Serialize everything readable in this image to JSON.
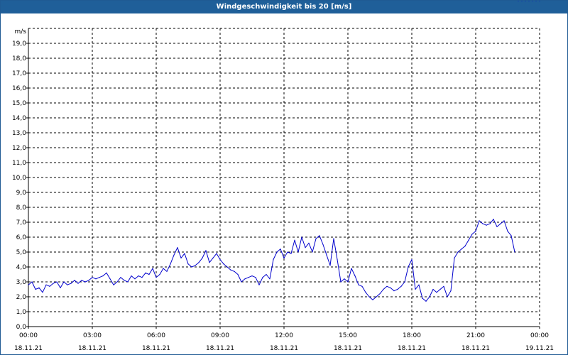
{
  "window": {
    "title": "Windgeschwindigkeit bis 20 [m/s]"
  },
  "chart_data": {
    "type": "line",
    "title": "Windgeschwindigkeit bis 20 [m/s]",
    "ylabel": "m/s",
    "ylim": [
      0,
      20
    ],
    "grid": true,
    "y_tick_labels": [
      "0,0",
      "1,0",
      "2,0",
      "3,0",
      "4,0",
      "5,0",
      "6,0",
      "7,0",
      "8,0",
      "9,0",
      "10,0",
      "11,0",
      "12,0",
      "13,0",
      "14,0",
      "15,0",
      "16,0",
      "17,0",
      "18,0",
      "19,0"
    ],
    "x_ticks": [
      {
        "time": "00:00",
        "date": "18.11.21"
      },
      {
        "time": "03:00",
        "date": "18.11.21"
      },
      {
        "time": "06:00",
        "date": "18.11.21"
      },
      {
        "time": "09:00",
        "date": "18.11.21"
      },
      {
        "time": "12:00",
        "date": "18.11.21"
      },
      {
        "time": "15:00",
        "date": "18.11.21"
      },
      {
        "time": "18:00",
        "date": "18.11.21"
      },
      {
        "time": "21:00",
        "date": "18.11.21"
      },
      {
        "time": "00:00",
        "date": "19.11.21"
      }
    ],
    "series": [
      {
        "color": "#0000cc",
        "x_hours": [
          0,
          0.1667,
          0.3333,
          0.5,
          0.6667,
          0.8333,
          1,
          1.1667,
          1.3333,
          1.5,
          1.6667,
          1.8333,
          2,
          2.1667,
          2.3333,
          2.5,
          2.6667,
          2.8333,
          3,
          3.1667,
          3.3333,
          3.5,
          3.6667,
          3.8333,
          4,
          4.1667,
          4.3333,
          4.5,
          4.6667,
          4.8333,
          5,
          5.1667,
          5.3333,
          5.5,
          5.6667,
          5.8333,
          6,
          6.1667,
          6.3333,
          6.5,
          6.6667,
          6.8333,
          7,
          7.1667,
          7.3333,
          7.5,
          7.6667,
          7.8333,
          8,
          8.1667,
          8.3333,
          8.5,
          8.6667,
          8.8333,
          9,
          9.1667,
          9.3333,
          9.5,
          9.6667,
          9.8333,
          10,
          10.1667,
          10.3333,
          10.5,
          10.6667,
          10.8333,
          11,
          11.1667,
          11.3333,
          11.5,
          11.6667,
          11.8333,
          12,
          12.1667,
          12.3333,
          12.5,
          12.6667,
          12.8333,
          13,
          13.1667,
          13.3333,
          13.5,
          13.6667,
          13.8333,
          14,
          14.1667,
          14.3333,
          14.5,
          14.6667,
          14.8333,
          15,
          15.1667,
          15.3333,
          15.5,
          15.6667,
          15.8333,
          16,
          16.1667,
          16.3333,
          16.5,
          16.6667,
          16.8333,
          17,
          17.1667,
          17.3333,
          17.5,
          17.6667,
          17.8333,
          18,
          18.1667,
          18.3333,
          18.5,
          18.6667,
          18.8333,
          19,
          19.1667,
          19.3333,
          19.5,
          19.6667,
          19.8333,
          20,
          20.1667,
          20.3333,
          20.5,
          20.6667,
          20.8333,
          21,
          21.1667,
          21.3333,
          21.5,
          21.6667,
          21.8333,
          22,
          22.1667,
          22.3333,
          22.5,
          22.6667,
          22.8333,
          23,
          23.1667,
          23.3333,
          23.5,
          23.6667,
          23.8333,
          24
        ],
        "values": [
          2.8,
          3.0,
          2.5,
          2.6,
          2.3,
          2.8,
          2.7,
          2.9,
          3.0,
          2.6,
          3.0,
          2.8,
          2.9,
          3.1,
          2.9,
          3.1,
          3.0,
          3.1,
          3.3,
          3.2,
          3.3,
          3.4,
          3.6,
          3.2,
          2.8,
          3.0,
          3.3,
          3.1,
          3.0,
          3.4,
          3.2,
          3.4,
          3.3,
          3.6,
          3.5,
          3.9,
          3.3,
          3.5,
          3.9,
          3.7,
          4.2,
          4.8,
          5.3,
          4.6,
          4.9,
          4.2,
          4.0,
          4.1,
          4.3,
          4.6,
          5.1,
          4.3,
          4.6,
          4.9,
          4.5,
          4.2,
          4.0,
          3.8,
          3.7,
          3.5,
          3.0,
          3.2,
          3.3,
          3.4,
          3.3,
          2.8,
          3.3,
          3.5,
          3.2,
          4.5,
          5.0,
          5.2,
          4.6,
          5.0,
          4.9,
          5.8,
          5.0,
          6.0,
          5.3,
          5.6,
          5.0,
          5.9,
          6.1,
          5.5,
          4.8,
          4.1,
          5.9,
          4.5,
          3.0,
          3.2,
          3.0,
          3.9,
          3.4,
          2.8,
          2.7,
          2.3,
          2.0,
          1.8,
          2.0,
          2.2,
          2.5,
          2.7,
          2.6,
          2.4,
          2.5,
          2.7,
          3.0,
          4.0,
          4.5,
          2.5,
          2.8,
          1.9,
          1.7,
          2.0,
          2.5,
          2.3,
          2.5,
          2.7,
          2.0,
          2.4,
          4.6,
          5.0,
          5.2,
          5.4,
          5.8,
          6.2,
          6.4,
          7.1,
          6.9,
          6.8,
          6.9,
          7.2,
          6.7,
          6.9,
          7.1,
          6.4,
          6.1,
          5.0
        ]
      }
    ]
  }
}
